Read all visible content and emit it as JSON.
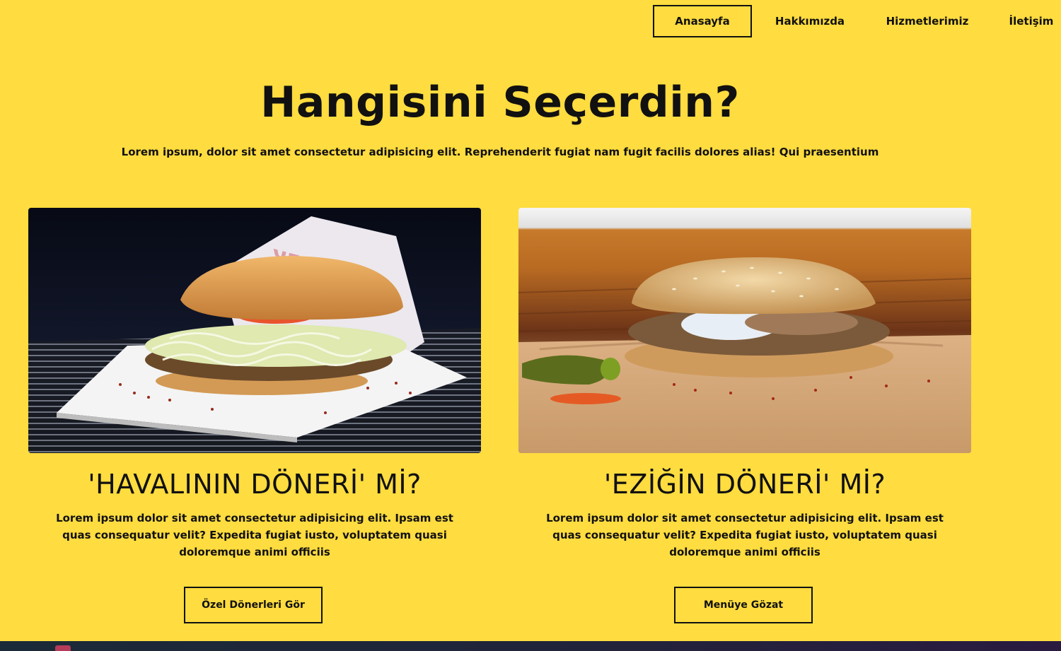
{
  "nav": {
    "items": [
      {
        "label": "Anasayfa",
        "active": true
      },
      {
        "label": "Hakkımızda",
        "active": false
      },
      {
        "label": "Hizmetlerimiz",
        "active": false
      },
      {
        "label": "İletişim",
        "active": false
      }
    ]
  },
  "hero": {
    "title": "Hangisini Seçerdin?",
    "subtitle": "Lorem ipsum, dolor sit amet consectetur adipisicing elit. Reprehenderit fugiat nam fugit facilis dolores alias! Qui praesentium"
  },
  "cards": [
    {
      "title": "'HAVALININ DÖNERİ' Mİ?",
      "text": "Lorem ipsum dolor sit amet consectetur adipisicing elit. Ipsam est quas consequatur velit? Expedita fugiat iusto, voluptatem quasi doloremque animi officiis",
      "button": "Özel Dönerleri Gör",
      "wrapper_print": "DÖNER"
    },
    {
      "title": "'EZİĞİN DÖNERİ' Mİ?",
      "text": "Lorem ipsum dolor sit amet consectetur adipisicing elit. Ipsam est quas consequatur velit? Expedita fugiat iusto, voluptatem quasi doloremque animi officiis",
      "button": "Menüye Gözat"
    }
  ],
  "colors": {
    "background": "#FFDC3F",
    "text": "#111111",
    "border": "#111111"
  }
}
